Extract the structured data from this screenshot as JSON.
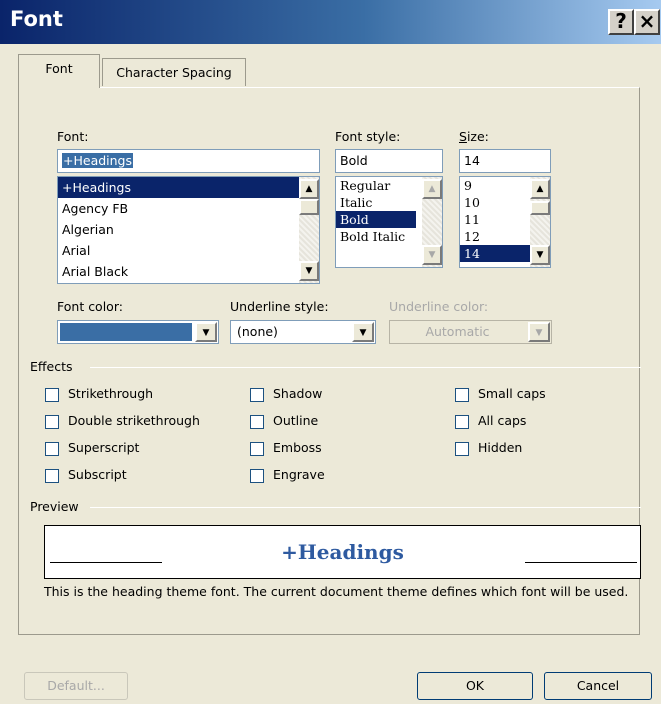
{
  "window": {
    "title": "Font",
    "help_glyph": "?",
    "close_glyph": "×"
  },
  "tabs": [
    {
      "label": "Font",
      "active": true
    },
    {
      "label": "Character Spacing",
      "active": false
    }
  ],
  "font": {
    "label": "Font:",
    "value": "+Headings",
    "items": [
      "+Headings",
      "Agency FB",
      "Algerian",
      "Arial",
      "Arial Black"
    ],
    "selected_index": 0
  },
  "font_style": {
    "label": "Font style:",
    "value": "Bold",
    "items": [
      "Regular",
      "Italic",
      "Bold",
      "Bold Italic"
    ],
    "selected_index": 2
  },
  "size": {
    "label": "Size:",
    "value": "14",
    "items": [
      "9",
      "10",
      "11",
      "12",
      "14"
    ],
    "selected_index": 4
  },
  "font_color": {
    "label": "Font color:",
    "swatch_color": "#3a6ea5"
  },
  "underline_style": {
    "label": "Underline style:",
    "value": "(none)"
  },
  "underline_color": {
    "label": "Underline color:",
    "value": "Automatic",
    "disabled": true
  },
  "effects": {
    "title": "Effects",
    "col1": [
      "Strikethrough",
      "Double strikethrough",
      "Superscript",
      "Subscript"
    ],
    "col2": [
      "Shadow",
      "Outline",
      "Emboss",
      "Engrave"
    ],
    "col3": [
      "Small caps",
      "All caps",
      "Hidden"
    ]
  },
  "preview": {
    "title": "Preview",
    "sample": "+Headings",
    "sample_color": "#2e5aa0",
    "description": "This is the heading theme font. The current document theme defines which font will be used."
  },
  "buttons": {
    "default": "Default...",
    "ok": "OK",
    "cancel": "Cancel"
  }
}
